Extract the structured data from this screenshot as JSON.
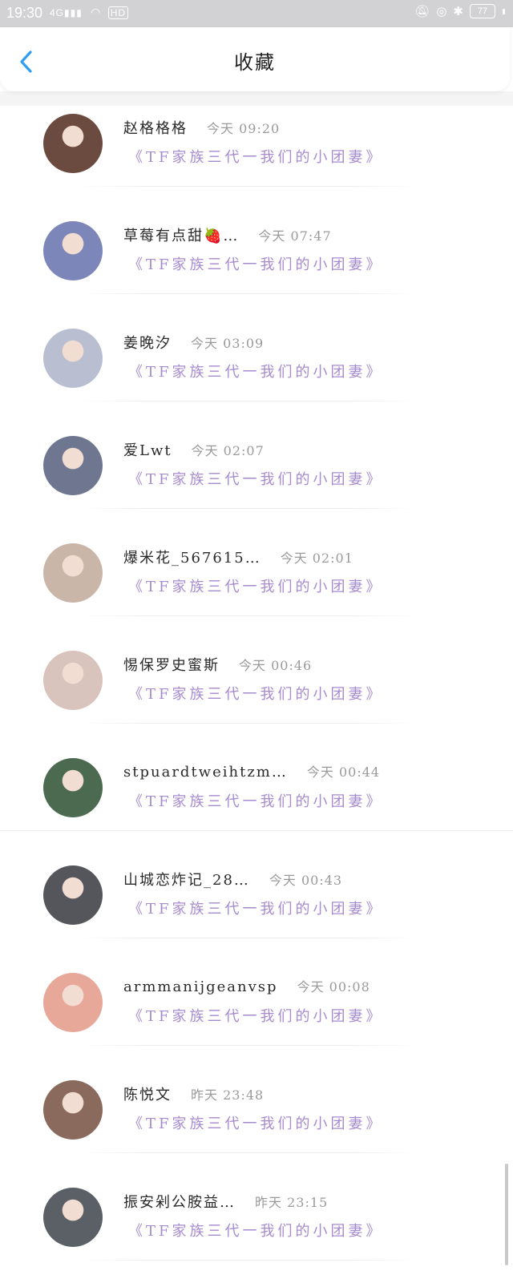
{
  "status_bar": {
    "time": "19:30",
    "signal_label": "4G",
    "hd_label": "HD",
    "battery": "77"
  },
  "header": {
    "title": "收藏",
    "back_icon": "chevron-left-icon"
  },
  "list": {
    "items": [
      {
        "username": "赵格格格",
        "time": "今天 09:20",
        "title": "《TF家族三代一我们的小团妻》",
        "avatar_color": "#6b4a40"
      },
      {
        "username": "草莓有点甜🍓…",
        "time": "今天 07:47",
        "title": "《TF家族三代一我们的小团妻》",
        "avatar_color": "#7d86b8"
      },
      {
        "username": "姜晚汐",
        "time": "今天 03:09",
        "title": "《TF家族三代一我们的小团妻》",
        "avatar_color": "#b9bfd1"
      },
      {
        "username": "爱Lwt",
        "time": "今天 02:07",
        "title": "《TF家族三代一我们的小团妻》",
        "avatar_color": "#6f7790"
      },
      {
        "username": "爆米花_567615…",
        "time": "今天 02:01",
        "title": "《TF家族三代一我们的小团妻》",
        "avatar_color": "#c9b6a9"
      },
      {
        "username": "惕保罗史蜜斯",
        "time": "今天 00:46",
        "title": "《TF家族三代一我们的小团妻》",
        "avatar_color": "#d8c4bd"
      },
      {
        "username": "stpuardtweihtzm…",
        "time": "今天 00:44",
        "title": "《TF家族三代一我们的小团妻》",
        "avatar_color": "#4c6a4f"
      },
      {
        "username": "山城恋炸记_28…",
        "time": "今天 00:43",
        "title": "《TF家族三代一我们的小团妻》",
        "avatar_color": "#55565c"
      },
      {
        "username": "armmanijgeanvsp",
        "time": "今天 00:08",
        "title": "《TF家族三代一我们的小团妻》",
        "avatar_color": "#e7a89a"
      },
      {
        "username": "陈悦文",
        "time": "昨天 23:48",
        "title": "《TF家族三代一我们的小团妻》",
        "avatar_color": "#8a6a5c"
      },
      {
        "username": "振安剁公胺益…",
        "time": "昨天 23:15",
        "title": "《TF家族三代一我们的小团妻》",
        "avatar_color": "#5a6066"
      }
    ]
  },
  "colors": {
    "accent_blue": "#2f9df2",
    "title_purple": "#a78bcf"
  }
}
